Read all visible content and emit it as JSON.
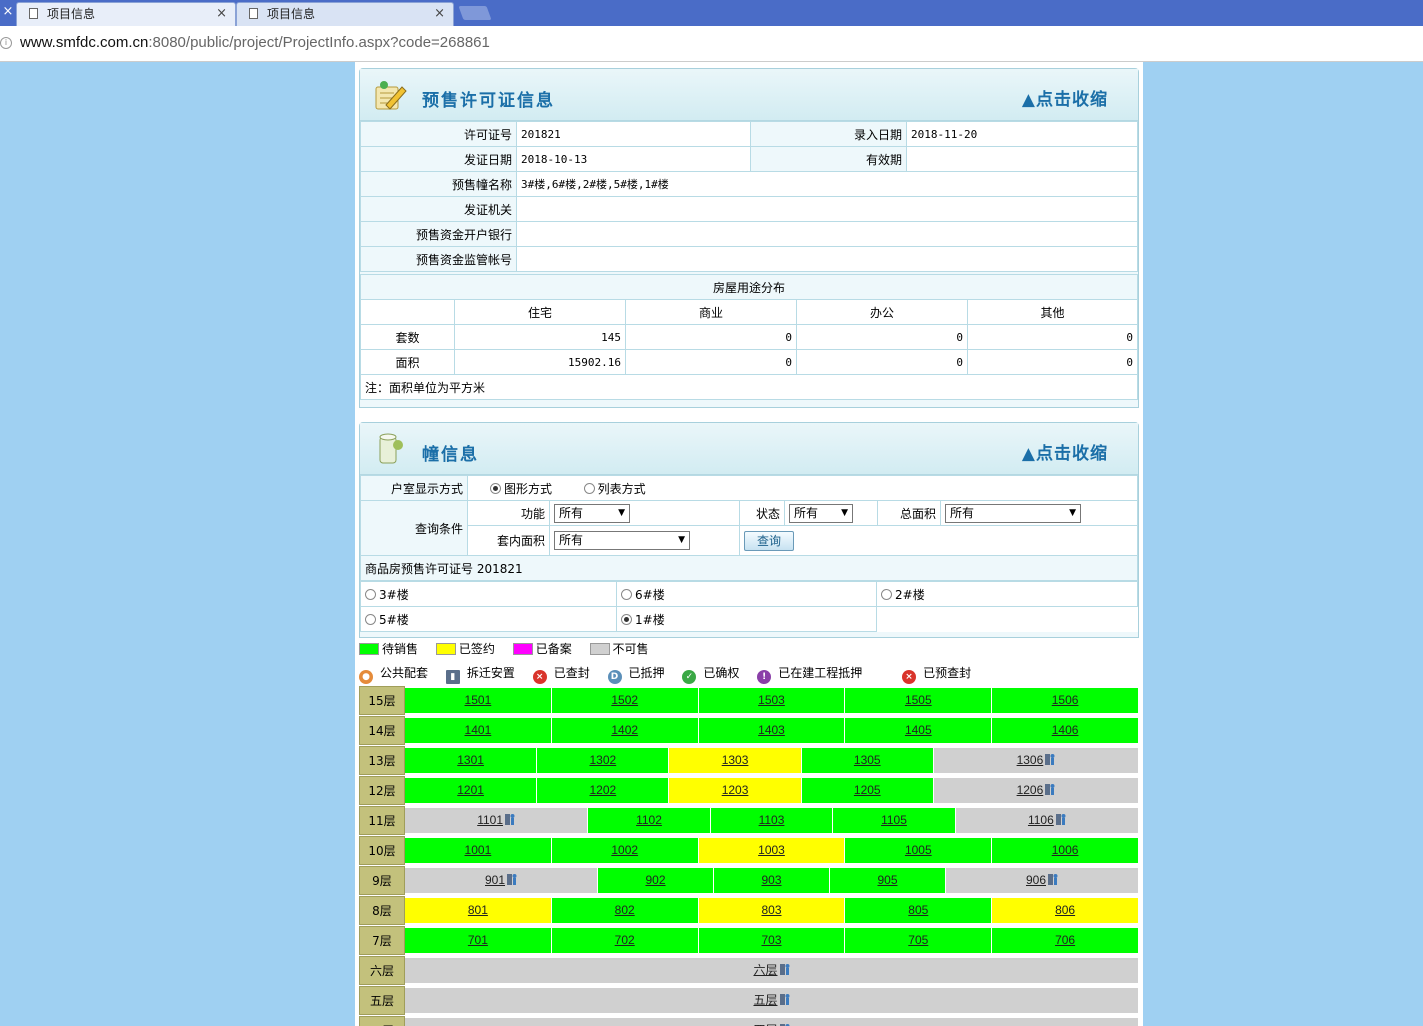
{
  "browser": {
    "tabs": [
      {
        "title": "项目信息"
      },
      {
        "title": "项目信息"
      }
    ],
    "url_host": "www.smfdc.com.cn",
    "url_rest": ":8080/public/project/ProjectInfo.aspx?code=268861"
  },
  "presale": {
    "title": "预售许可证信息",
    "toggle": "▲点击收缩",
    "fields": {
      "permit_no_label": "许可证号",
      "permit_no": "201821",
      "entry_date_label": "录入日期",
      "entry_date": "2018-11-20",
      "issue_date_label": "发证日期",
      "issue_date": "2018-10-13",
      "valid_label": "有效期",
      "valid": "",
      "buildings_label": "预售幢名称",
      "buildings": "3#楼,6#楼,2#楼,5#楼,1#楼",
      "authority_label": "发证机关",
      "authority": "",
      "bank_label": "预售资金开户银行",
      "bank": "",
      "account_label": "预售资金监管帐号",
      "account": ""
    },
    "usage": {
      "title": "房屋用途分布",
      "headers": [
        "住宅",
        "商业",
        "办公",
        "其他"
      ],
      "rows": [
        {
          "label": "套数",
          "values": [
            "145",
            "0",
            "0",
            "0"
          ]
        },
        {
          "label": "面积",
          "values": [
            "15902.16",
            "0",
            "0",
            "0"
          ]
        }
      ],
      "note": "注：面积单位为平方米"
    }
  },
  "building": {
    "title": "幢信息",
    "toggle": "▲点击收缩",
    "display_label": "户室显示方式",
    "display_opts": [
      "图形方式",
      "列表方式"
    ],
    "query_label": "查询条件",
    "func_label": "功能",
    "func_val": "所有",
    "status_label": "状态",
    "status_val": "所有",
    "area_label": "总面积",
    "area_val": "所有",
    "inner_label": "套内面积",
    "inner_val": "所有",
    "query_btn": "查询",
    "permit_line": "商品房预售许可证号 201821",
    "buildings": [
      "3#楼",
      "6#楼",
      "2#楼",
      "5#楼",
      "1#楼"
    ],
    "legend": [
      "待销售",
      "已签约",
      "已备案",
      "不可售"
    ],
    "legend_colors": [
      "#00ff00",
      "#ffff00",
      "#ff00ff",
      "#d0d0d0"
    ],
    "icons": [
      "公共配套",
      "拆迁安置",
      "已查封",
      "已抵押",
      "已确权",
      "已在建工程抵押",
      "已预查封"
    ]
  },
  "floors": [
    {
      "label": "15层",
      "units": [
        [
          "1501",
          "g",
          1
        ],
        [
          "1502",
          "g",
          1
        ],
        [
          "1503",
          "g",
          1
        ],
        [
          "1505",
          "g",
          1
        ],
        [
          "1506",
          "g",
          1
        ]
      ]
    },
    {
      "label": "14层",
      "units": [
        [
          "1401",
          "g",
          1
        ],
        [
          "1402",
          "g",
          1
        ],
        [
          "1403",
          "g",
          1
        ],
        [
          "1405",
          "g",
          1
        ],
        [
          "1406",
          "g",
          1
        ]
      ]
    },
    {
      "label": "13层",
      "units": [
        [
          "1301",
          "g",
          0.9
        ],
        [
          "1302",
          "g",
          0.9
        ],
        [
          "1303",
          "y",
          0.9
        ],
        [
          "1305",
          "g",
          0.9
        ],
        [
          "1306",
          "gr",
          1.4,
          1
        ]
      ]
    },
    {
      "label": "12层",
      "units": [
        [
          "1201",
          "g",
          0.9
        ],
        [
          "1202",
          "g",
          0.9
        ],
        [
          "1203",
          "y",
          0.9
        ],
        [
          "1205",
          "g",
          0.9
        ],
        [
          "1206",
          "gr",
          1.4,
          1
        ]
      ]
    },
    {
      "label": "11层",
      "units": [
        [
          "1101",
          "gr",
          1.5,
          1
        ],
        [
          "1102",
          "g",
          1
        ],
        [
          "1103",
          "g",
          1
        ],
        [
          "1105",
          "g",
          1
        ],
        [
          "1106",
          "gr",
          1.5,
          1
        ]
      ]
    },
    {
      "label": "10层",
      "units": [
        [
          "1001",
          "g",
          1
        ],
        [
          "1002",
          "g",
          1
        ],
        [
          "1003",
          "y",
          1
        ],
        [
          "1005",
          "g",
          1
        ],
        [
          "1006",
          "g",
          1
        ]
      ]
    },
    {
      "label": "9层",
      "units": [
        [
          "901",
          "gr",
          1.67,
          1
        ],
        [
          "902",
          "g",
          1
        ],
        [
          "903",
          "g",
          1
        ],
        [
          "905",
          "g",
          1
        ],
        [
          "906",
          "gr",
          1.67,
          1
        ]
      ]
    },
    {
      "label": "8层",
      "units": [
        [
          "801",
          "y",
          1
        ],
        [
          "802",
          "g",
          1
        ],
        [
          "803",
          "y",
          1
        ],
        [
          "805",
          "g",
          1
        ],
        [
          "806",
          "y",
          1
        ]
      ]
    },
    {
      "label": "7层",
      "units": [
        [
          "701",
          "g",
          1
        ],
        [
          "702",
          "g",
          1
        ],
        [
          "703",
          "g",
          1
        ],
        [
          "705",
          "g",
          1
        ],
        [
          "706",
          "g",
          1
        ]
      ]
    },
    {
      "label": "六层",
      "units": [
        [
          "六层",
          "gr",
          1,
          1
        ]
      ]
    },
    {
      "label": "五层",
      "units": [
        [
          "五层",
          "gr",
          1,
          1
        ]
      ]
    },
    {
      "label": "四层",
      "units": [
        [
          "四层",
          "gr",
          1,
          1
        ]
      ]
    }
  ]
}
